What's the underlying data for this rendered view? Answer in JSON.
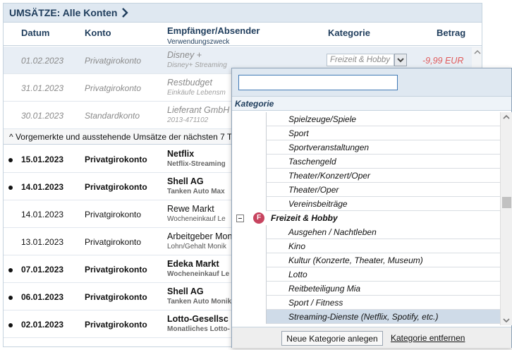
{
  "title": "UMSÄTZE: Alle Konten",
  "columns": {
    "datum": "Datum",
    "konto": "Konto",
    "empfaenger": "Empfänger/Absender",
    "zweck": "Verwendungszweck",
    "kategorie": "Kategorie",
    "betrag": "Betrag"
  },
  "pending_rows": [
    {
      "date": "01.02.2023",
      "account": "Privatgirokonto",
      "payee": "Disney +",
      "purpose": "Disney+ Streaming",
      "category": "Freizeit & Hobby",
      "amount": "-9,99 EUR"
    },
    {
      "date": "31.01.2023",
      "account": "Privatgirokonto",
      "payee": "Restbudget",
      "purpose": "Einkäufe Lebensm"
    },
    {
      "date": "30.01.2023",
      "account": "Standardkonto",
      "payee": "Lieferant GmbH",
      "purpose": "2013-471102"
    }
  ],
  "section_label": "^ Vorgemerkte und ausstehende Umsätze der nächsten 7 T",
  "booked_rows": [
    {
      "date": "15.01.2023",
      "account": "Privatgirokonto",
      "payee": "Netflix",
      "purpose": "Netflix-Streaming"
    },
    {
      "date": "14.01.2023",
      "account": "Privatgirokonto",
      "payee": "Shell AG",
      "purpose": "Tanken Auto Max"
    },
    {
      "date": "14.01.2023",
      "account": "Privatgirokonto",
      "payee": "Rewe Markt",
      "purpose": "Wocheneinkauf Le"
    },
    {
      "date": "13.01.2023",
      "account": "Privatgirokonto",
      "payee": "Arbeitgeber Mon",
      "purpose": "Lohn/Gehalt Monik"
    },
    {
      "date": "07.01.2023",
      "account": "Privatgirokonto",
      "payee": "Edeka Markt",
      "purpose": "Wocheneinkauf Le"
    },
    {
      "date": "06.01.2023",
      "account": "Privatgirokonto",
      "payee": "Shell AG",
      "purpose": "Tanken Auto Monik"
    },
    {
      "date": "02.01.2023",
      "account": "Privatgirokonto",
      "payee": "Lotto-Gesellsc",
      "purpose": "Monatliches Lotto-"
    }
  ],
  "popup": {
    "search_value": "",
    "header": "Kategorie",
    "items_before": [
      "Spielzeuge/Spiele",
      "Sport",
      "Sportveranstaltungen",
      "Taschengeld",
      "Theater/Konzert/Oper",
      "Theater/Oper",
      "Vereinsbeiträge"
    ],
    "group": {
      "badge": "F",
      "label": "Freizeit & Hobby"
    },
    "items_after": [
      "Ausgehen / Nachtleben",
      "Kino",
      "Kultur (Konzerte, Theater, Museum)",
      "Lotto",
      "Reitbeteiligung Mia",
      "Sport / Fitness",
      "Streaming-Dienste (Netflix, Spotify, etc.)"
    ],
    "new_button": "Neue Kategorie anlegen",
    "delete_link": "Kategorie entfernen"
  },
  "colors": {
    "accent": "#1f3d5c",
    "negative": "#e05a5a",
    "badge": "#c7445f"
  }
}
